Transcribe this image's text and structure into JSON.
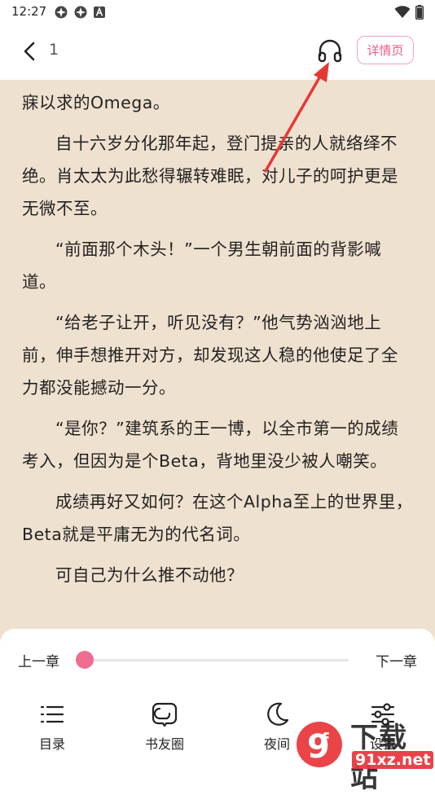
{
  "status_bar": {
    "time": "12:27"
  },
  "header": {
    "page_number": "1",
    "detail_label": "详情页"
  },
  "content": {
    "paragraphs": [
      "寐以求的Omega。",
      "自十六岁分化那年起，登门提亲的人就络绎不绝。肖太太为此愁得辗转难眠，对儿子的呵护更是无微不至。",
      "“前面那个木头！”一个男生朝前面的背影喊道。",
      "“给老子让开，听见没有？”他气势汹汹地上前，伸手想推开对方，却发现这人稳的他使足了全力都没能撼动一分。",
      "“是你？”建筑系的王一博，以全市第一的成绩考入，但因为是个Beta，背地里没少被人嘲笑。",
      "成绩再好又如何？在这个Alpha至上的世界里，Beta就是平庸无为的代名词。",
      "可自己为什么推不动他？"
    ]
  },
  "reader_controls": {
    "prev_label": "上一章",
    "next_label": "下一章",
    "progress": 0.0
  },
  "bottom_nav": [
    {
      "label": "目录",
      "icon": "list-icon"
    },
    {
      "label": "书友圈",
      "icon": "chat-bubble-icon"
    },
    {
      "label": "夜间",
      "icon": "moon-icon"
    },
    {
      "label": "设置",
      "icon": "sliders-icon"
    }
  ],
  "watermark": {
    "title": "下载站",
    "url": "91xz.net"
  },
  "colors": {
    "accent": "#ee5d85",
    "reading_bg": "#efe1cf",
    "annotation": "#e53935"
  }
}
